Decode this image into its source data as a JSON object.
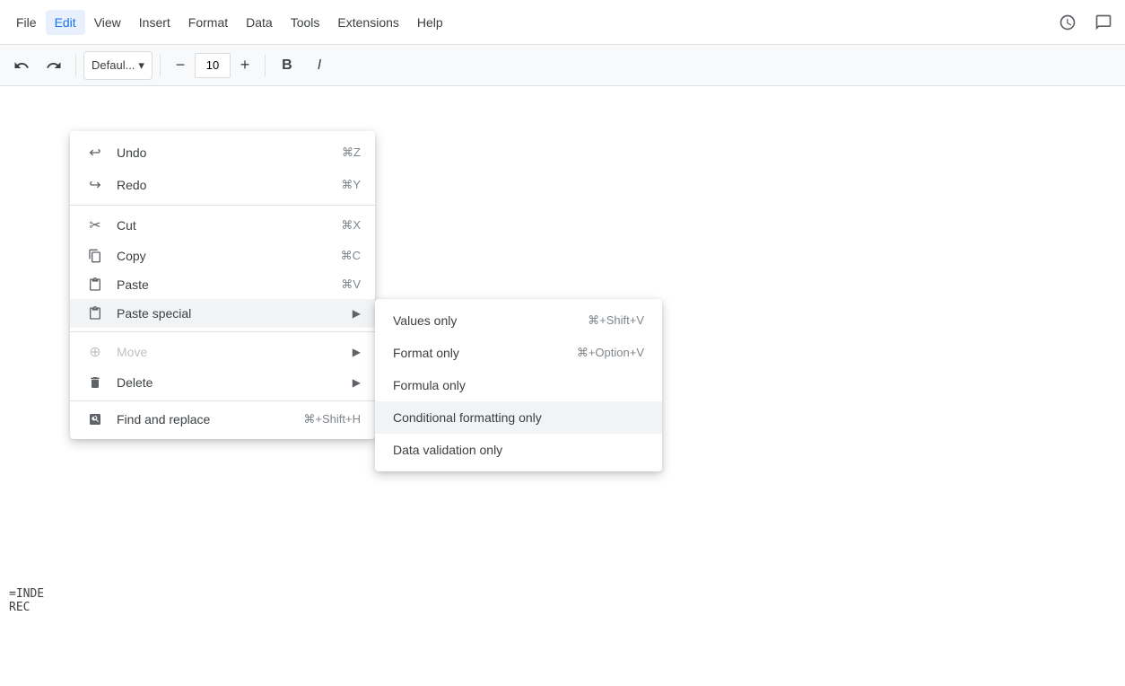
{
  "menubar": {
    "items": [
      {
        "label": "File",
        "active": false
      },
      {
        "label": "Edit",
        "active": true
      },
      {
        "label": "View",
        "active": false
      },
      {
        "label": "Insert",
        "active": false
      },
      {
        "label": "Format",
        "active": false
      },
      {
        "label": "Data",
        "active": false
      },
      {
        "label": "Tools",
        "active": false
      },
      {
        "label": "Extensions",
        "active": false
      },
      {
        "label": "Help",
        "active": false
      }
    ]
  },
  "toolbar": {
    "font_name": "Defaul...",
    "font_size": "10",
    "bold_label": "B",
    "italic_label": "I"
  },
  "edit_menu": {
    "items": [
      {
        "id": "undo",
        "label": "Undo",
        "shortcut": "⌘Z",
        "icon": "↩",
        "disabled": false,
        "has_arrow": false
      },
      {
        "id": "redo",
        "label": "Redo",
        "shortcut": "⌘Y",
        "icon": "↪",
        "disabled": false,
        "has_arrow": false
      },
      {
        "id": "divider1"
      },
      {
        "id": "cut",
        "label": "Cut",
        "shortcut": "⌘X",
        "icon": "✂",
        "disabled": false,
        "has_arrow": false
      },
      {
        "id": "copy",
        "label": "Copy",
        "shortcut": "⌘C",
        "icon": "⧉",
        "disabled": false,
        "has_arrow": false
      },
      {
        "id": "paste",
        "label": "Paste",
        "shortcut": "⌘V",
        "icon": "📋",
        "disabled": false,
        "has_arrow": false
      },
      {
        "id": "paste_special",
        "label": "Paste special",
        "shortcut": "",
        "icon": "📋",
        "disabled": false,
        "has_arrow": true,
        "highlighted": true
      },
      {
        "id": "divider2"
      },
      {
        "id": "move",
        "label": "Move",
        "shortcut": "",
        "icon": "⊕",
        "disabled": true,
        "has_arrow": true
      },
      {
        "id": "delete",
        "label": "Delete",
        "shortcut": "",
        "icon": "🗑",
        "disabled": false,
        "has_arrow": true
      },
      {
        "id": "divider3"
      },
      {
        "id": "find_replace",
        "label": "Find and replace",
        "shortcut": "⌘+Shift+H",
        "icon": "↻",
        "disabled": false,
        "has_arrow": false
      }
    ]
  },
  "paste_special_submenu": {
    "items": [
      {
        "id": "values_only",
        "label": "Values only",
        "shortcut": "⌘+Shift+V",
        "highlighted": false
      },
      {
        "id": "format_only",
        "label": "Format only",
        "shortcut": "⌘+Option+V",
        "highlighted": false
      },
      {
        "id": "formula_only",
        "label": "Formula only",
        "shortcut": "",
        "highlighted": false
      },
      {
        "id": "conditional_formatting_only",
        "label": "Conditional formatting only",
        "shortcut": "",
        "highlighted": true
      },
      {
        "id": "data_validation_only",
        "label": "Data validation only",
        "shortcut": "",
        "highlighted": false
      }
    ]
  },
  "spreadsheet": {
    "cell_formula": "=INDE\nREC"
  }
}
